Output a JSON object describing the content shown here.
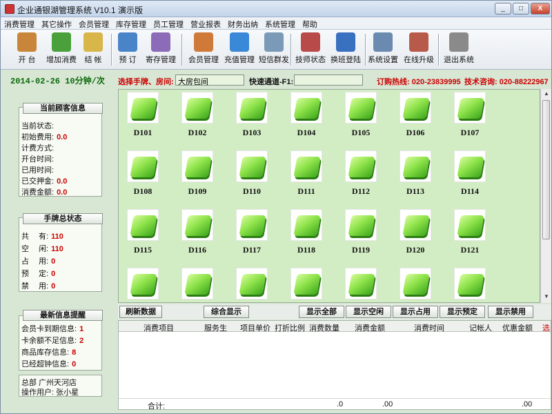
{
  "window": {
    "title": "企业通银湖管理系统 V10.1 演示版",
    "min": "_",
    "max": "□",
    "close": "X"
  },
  "menu": [
    "消费管理",
    "其它操作",
    "会员管理",
    "库存管理",
    "员工管理",
    "营业报表",
    "财务出纳",
    "系统管理",
    "帮助"
  ],
  "toolbar": [
    {
      "label": "开 台",
      "icon": "people-icon",
      "color": "#c9863b"
    },
    {
      "label": "增加消费",
      "icon": "cart-add-icon",
      "color": "#4aa03a"
    },
    {
      "label": "结 帐",
      "icon": "coins-icon",
      "color": "#d8b64a"
    },
    {
      "label": "预 订",
      "icon": "book-icon",
      "color": "#4a84c8"
    },
    {
      "label": "寄存管理",
      "icon": "package-icon",
      "color": "#8c6bb8"
    },
    {
      "label": "会员管理",
      "icon": "members-icon",
      "color": "#d07a3a"
    },
    {
      "label": "充值管理",
      "icon": "smiley-icon",
      "color": "#3a88d8"
    },
    {
      "label": "短信群发",
      "icon": "phone-icon",
      "color": "#7a9ab8"
    },
    {
      "label": "技师状态",
      "icon": "badge-icon",
      "color": "#b84a4a"
    },
    {
      "label": "换班登陆",
      "icon": "compass-icon",
      "color": "#3a70c0"
    },
    {
      "label": "系统设置",
      "icon": "settings-icon",
      "color": "#6a8ab0"
    },
    {
      "label": "在线升级",
      "icon": "upgrade-icon",
      "color": "#b85a4a"
    },
    {
      "label": "退出系统",
      "icon": "exit-icon",
      "color": "#8a8a8a"
    }
  ],
  "status": {
    "date": "2014-02-26  10分钟/次",
    "select_label": "选择手牌、房间:",
    "select_value": "大房包间",
    "quick_label": "快速通道-F1:",
    "quick_value": "",
    "order_hotline": "订购热线: 020-23839995",
    "tech_hotline": "技术咨询: 020-88222967"
  },
  "consumption": {
    "title": "当前顾客信息",
    "rows": [
      {
        "label": "当前状态:",
        "value": ""
      },
      {
        "label": "初始费用:",
        "value": "0.0"
      },
      {
        "label": "计费方式:",
        "value": ""
      },
      {
        "label": "开台时间:",
        "value": ""
      },
      {
        "label": "已用时间:",
        "value": ""
      },
      {
        "label": "已交押金:",
        "value": "0.0"
      },
      {
        "label": "消费金额:",
        "value": "0.0"
      }
    ]
  },
  "handcard": {
    "title": "手牌总状态",
    "rows": [
      {
        "label": "共　 有:",
        "value": "110"
      },
      {
        "label": "空　 闲:",
        "value": "110"
      },
      {
        "label": "占　 用:",
        "value": "0"
      },
      {
        "label": "预　 定:",
        "value": "0"
      },
      {
        "label": "禁　 用:",
        "value": "0"
      }
    ]
  },
  "latest": {
    "title": "最新信息提醒",
    "rows": [
      {
        "label": "会员卡到期信息:",
        "value": "1"
      },
      {
        "label": "卡余额不足信息:",
        "value": "2"
      },
      {
        "label": "商品库存信息:",
        "value": "8"
      },
      {
        "label": "已经超钟信息:",
        "value": "0"
      }
    ],
    "store": "总部   广州天河店",
    "operator": "操作用户: 张小星"
  },
  "rooms": [
    "D101",
    "D102",
    "D103",
    "D104",
    "D105",
    "D106",
    "D107",
    "D108",
    "D109",
    "D110",
    "D111",
    "D112",
    "D113",
    "D114",
    "D115",
    "D116",
    "D117",
    "D118",
    "D119",
    "D120",
    "D121",
    "",
    "",
    "",
    "",
    "",
    "",
    ""
  ],
  "buttons": {
    "refresh": "刷新数据",
    "summary": "综合显示",
    "all": "显示全部",
    "free": "显示空闲",
    "used": "显示占用",
    "reserved": "显示预定",
    "disabled": "显示禁用"
  },
  "table": {
    "columns": [
      "消费项目",
      "服务生",
      "项目单价",
      "打折比例",
      "消费数量",
      "消费金额",
      "消费时间",
      "记帐人",
      "优惠金额",
      "选"
    ],
    "total_label": "合计:",
    "total_qty": ".0",
    "total_amount": ".00",
    "total_discount": ".00"
  }
}
